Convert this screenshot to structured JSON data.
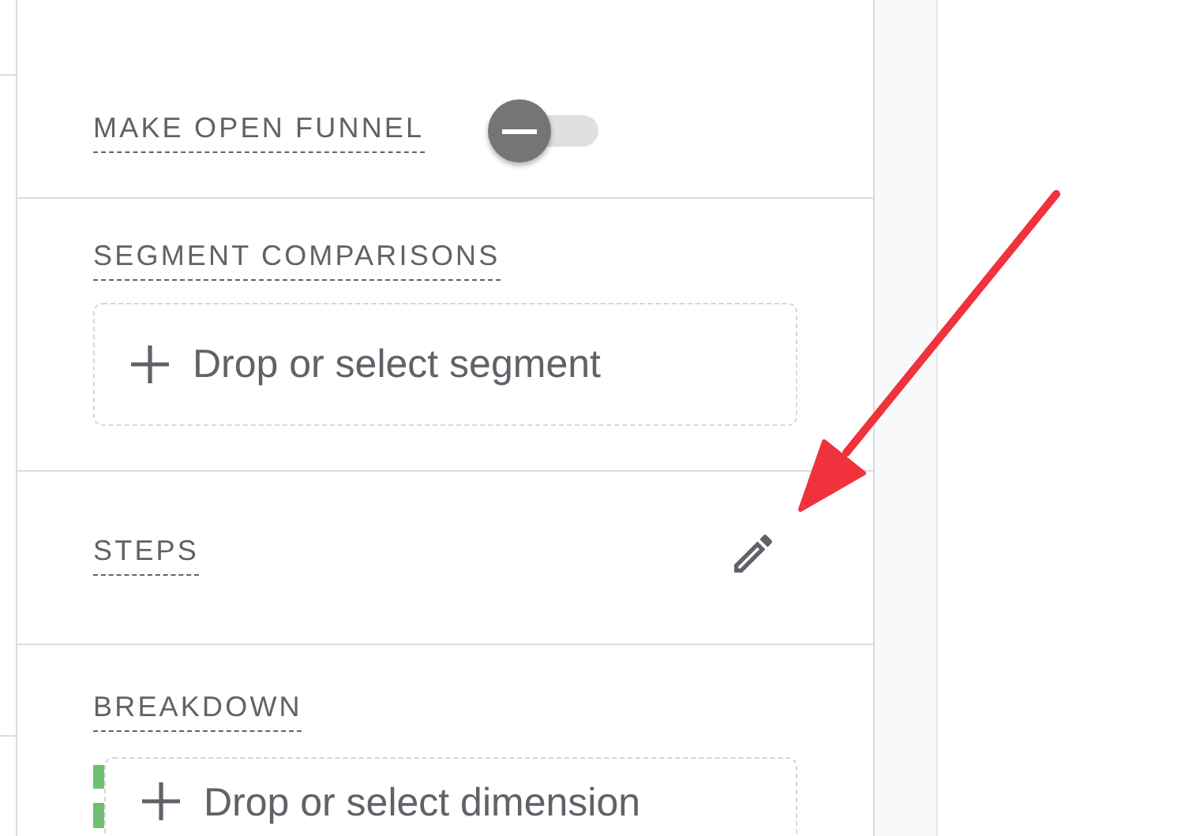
{
  "sections": [
    {
      "kind": "toggle",
      "label": "MAKE OPEN FUNNEL",
      "on": false
    },
    {
      "kind": "drop",
      "label": "SEGMENT COMPARISONS",
      "prompt": "Drop or select segment"
    },
    {
      "kind": "edit",
      "label": "STEPS"
    },
    {
      "kind": "drop",
      "label": "BREAKDOWN",
      "prompt": "Drop or select dimension",
      "marked": true
    }
  ]
}
